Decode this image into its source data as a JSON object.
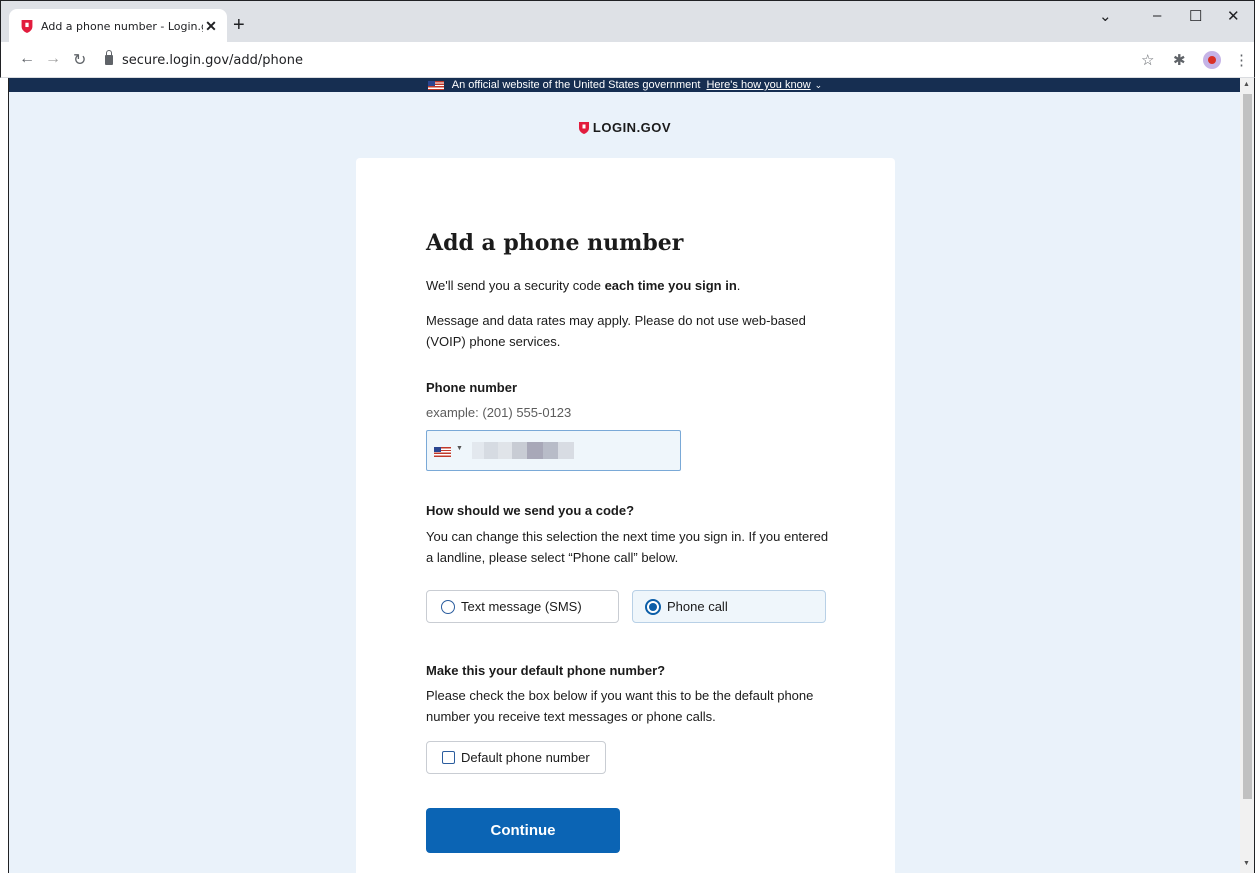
{
  "browser": {
    "tab_title": "Add a phone number - Login.gov",
    "url": "secure.login.gov/add/phone",
    "new_tab": "+",
    "tab_close": "✕"
  },
  "banner": {
    "text": "An official website of the United States government",
    "link": "Here's how you know"
  },
  "logo": {
    "text": "LOGIN.GOV"
  },
  "form": {
    "title": "Add a phone number",
    "intro_before": "We'll send you a security code ",
    "intro_bold": "each time you sign in",
    "intro_after": ".",
    "rates_note": "Message and data rates may apply. Please do not use web-based (VOIP) phone services.",
    "phone_label": "Phone number",
    "phone_hint": "example: (201) 555-0123",
    "delivery_heading": "How should we send you a code?",
    "delivery_note": "You can change this selection the next time you sign in. If you entered a landline, please select “Phone call” below.",
    "option_sms": "Text message (SMS)",
    "option_call": "Phone call",
    "selected_option": "Phone call",
    "default_heading": "Make this your default phone number?",
    "default_note": "Please check the box below if you want this to be the default phone number you receive text messages or phone calls.",
    "default_checkbox": "Default phone number",
    "default_checked": false,
    "submit": "Continue"
  }
}
